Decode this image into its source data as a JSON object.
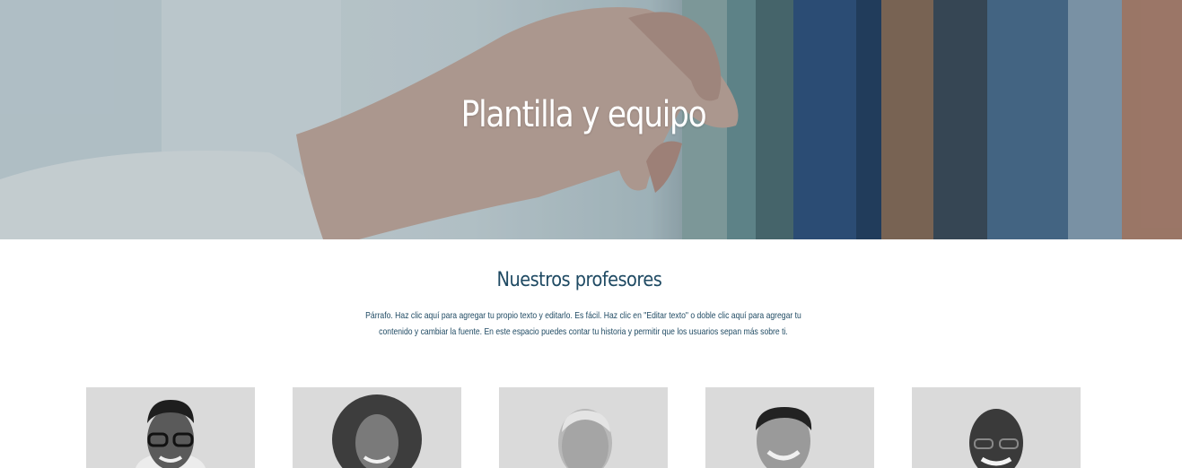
{
  "hero": {
    "title": "Plantilla y equipo",
    "image": "hand-pulling-book-from-shelf-photo"
  },
  "section": {
    "title": "Nuestros profesores",
    "paragraph": "Párrafo. Haz clic aquí para agregar tu propio texto y editarlo. Es fácil. Haz clic en \"Editar texto\" o doble clic aquí para agregar tu contenido y cambiar la fuente. En este espacio puedes contar tu historia y permitir que los usuarios sepan más sobre ti."
  },
  "team": [
    {
      "photo": "man-with-glasses-portrait"
    },
    {
      "photo": "woman-curly-hair-portrait"
    },
    {
      "photo": "woman-blonde-portrait"
    },
    {
      "photo": "man-smiling-portrait"
    },
    {
      "photo": "man-bald-glasses-portrait"
    }
  ],
  "colors": {
    "heading": "#1f4a63",
    "hero_text": "#ffffff",
    "card_bg": "#d9d9d9"
  }
}
